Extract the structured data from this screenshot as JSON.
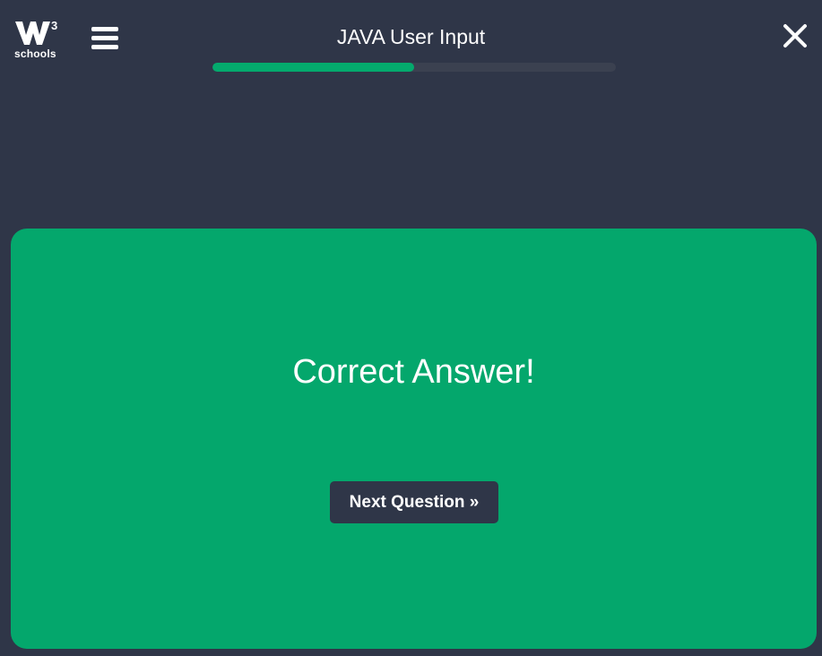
{
  "header": {
    "logo_text": "schools",
    "logo_superscript": "3",
    "title": "JAVA User Input",
    "menu_icon": "hamburger-menu-icon",
    "close_icon": "close-icon"
  },
  "progress": {
    "fraction": 0.5
  },
  "result": {
    "message": "Correct Answer!",
    "next_label": "Next Question »"
  },
  "colors": {
    "background": "#2f3648",
    "accent": "#04aa6d",
    "card": "#04a76c",
    "track": "#3b4150"
  }
}
